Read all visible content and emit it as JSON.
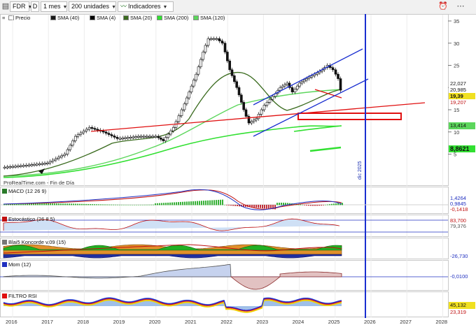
{
  "toolbar": {
    "symbol": "FDR",
    "drawing_label": "D",
    "period": "1 mes",
    "units": "200 unidades",
    "indicators": "Indicadores",
    "alarm_icon": "alarm-clock-icon",
    "more_icon": "dots-icon"
  },
  "legend": {
    "price": "Precio",
    "sma40": "SMA (40)",
    "sma4": "SMA (4)",
    "sma20": "SMA (20)",
    "sma200": "SMA (200)",
    "sma120": "SMA (120)"
  },
  "watermark": "ProRealTime.com - Fin de Día",
  "vertical_date": "dic 2025",
  "colors": {
    "sma40": "#1a1a1a",
    "sma4": "#000000",
    "sma20": "#3a6b1e",
    "sma200": "#31e031",
    "sma120": "#5cd65c",
    "trendline_red": "#e01010",
    "channel_blue": "#1a2fd0",
    "up_candle": "#ffffff",
    "down_candle": "#000000"
  },
  "price_axis": {
    "ticks": [
      "35",
      "30",
      "25",
      "20",
      "15",
      "10",
      "5"
    ],
    "tags": [
      "22,027",
      "20,985",
      "19,39",
      "19,207",
      "13,414",
      "8,8621"
    ]
  },
  "panels": [
    {
      "name": "MACD (12 26 9)",
      "ticks": [
        "5",
        "0"
      ],
      "tags": [
        "1,4264",
        "0,9845",
        "-0,1418"
      ]
    },
    {
      "name": "Estocástico (26 8 5)",
      "ticks": [
        "80",
        "20"
      ],
      "tags": [
        "83,700",
        "79,376"
      ]
    },
    {
      "name": "Blai5 Koncorde v.09 (15)",
      "ticks": [
        "200",
        "100",
        "0",
        "-100"
      ],
      "tags": [
        "-26,730"
      ]
    },
    {
      "name": "Mom (12)",
      "ticks": [
        "20",
        "10",
        "0",
        "-10"
      ],
      "tags": [
        "-0,0100"
      ]
    },
    {
      "name": "FILTRO RSI",
      "ticks": [
        "100",
        "50",
        "0"
      ],
      "tags": [
        "45,132",
        "23,319"
      ]
    }
  ],
  "x_axis": [
    "2016",
    "2017",
    "2018",
    "2019",
    "2020",
    "2021",
    "2022",
    "2023",
    "2024",
    "2025",
    "2026",
    "2027",
    "2028"
  ],
  "chart_data": {
    "type": "line",
    "x": [
      "2016",
      "2017",
      "2018",
      "2019",
      "2020",
      "2021",
      "2022",
      "2023",
      "2024",
      "2025"
    ],
    "series": [
      {
        "name": "Precio",
        "values": [
          2.5,
          4,
          12,
          9,
          10,
          20,
          29,
          13,
          20,
          22
        ]
      }
    ],
    "ylim": [
      0,
      37
    ]
  }
}
